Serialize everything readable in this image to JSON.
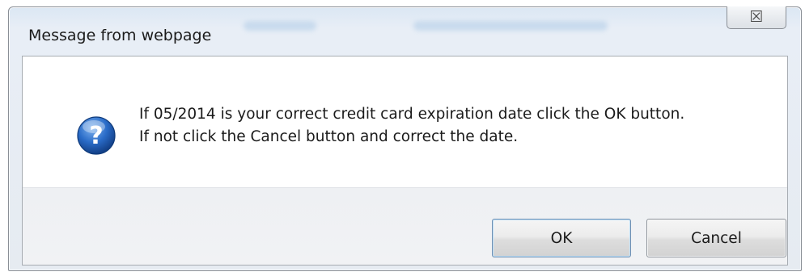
{
  "dialog": {
    "title": "Message from webpage",
    "close_glyph": "☒",
    "icon": "question-icon",
    "message_lines": [
      "If 05/2014 is your correct credit card expiration date click the OK button.",
      "If not click the Cancel button and correct the date."
    ],
    "buttons": {
      "ok_label": "OK",
      "cancel_label": "Cancel"
    }
  },
  "colors": {
    "icon_blue": "#1f5fb8",
    "focus_border": "#6f8fb2"
  }
}
